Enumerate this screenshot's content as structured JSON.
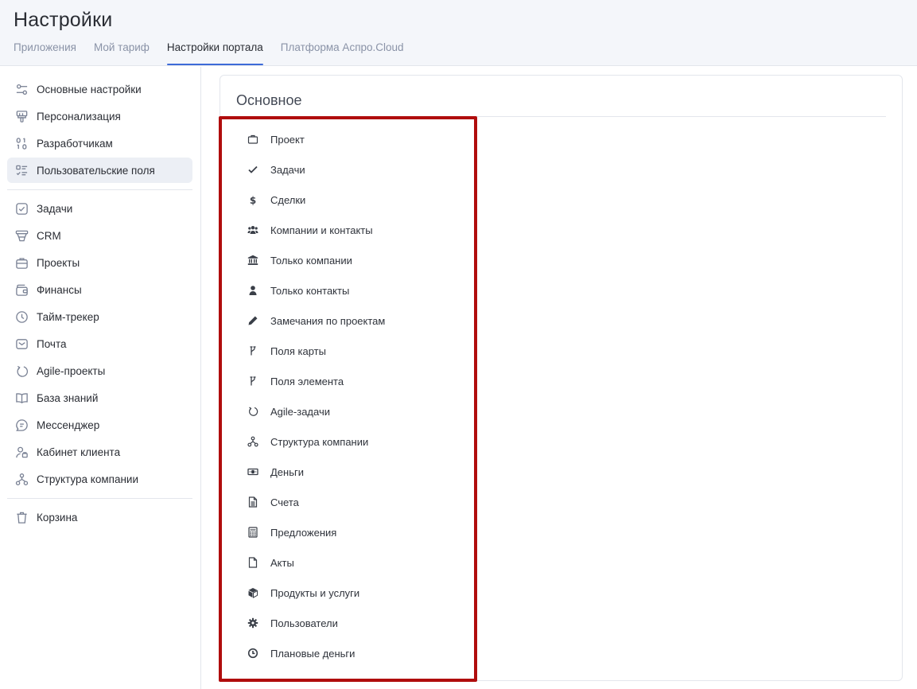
{
  "header": {
    "title": "Настройки",
    "tabs": [
      {
        "label": "Приложения"
      },
      {
        "label": "Мой тариф"
      },
      {
        "label": "Настройки портала"
      },
      {
        "label": "Платформа Аспро.Cloud"
      }
    ],
    "active_tab": "Настройки портала"
  },
  "sidebar": {
    "group1": [
      {
        "label": "Основные настройки",
        "icon": "sliders-icon"
      },
      {
        "label": "Персонализация",
        "icon": "paint-roller-icon"
      },
      {
        "label": "Разработчикам",
        "icon": "binary-code-icon"
      },
      {
        "label": "Пользовательские поля",
        "icon": "checklist-icon"
      }
    ],
    "group2": [
      {
        "label": "Задачи",
        "icon": "checkbox-icon"
      },
      {
        "label": "CRM",
        "icon": "funnel-icon"
      },
      {
        "label": "Проекты",
        "icon": "briefcase-icon"
      },
      {
        "label": "Финансы",
        "icon": "wallet-icon"
      },
      {
        "label": "Тайм-трекер",
        "icon": "clock-icon"
      },
      {
        "label": "Почта",
        "icon": "envelope-icon"
      },
      {
        "label": "Agile-проекты",
        "icon": "cycle-arrow-icon"
      },
      {
        "label": "База знаний",
        "icon": "open-book-icon"
      },
      {
        "label": "Мессенджер",
        "icon": "chat-bubble-icon"
      },
      {
        "label": "Кабинет клиента",
        "icon": "client-cabinet-icon"
      },
      {
        "label": "Структура компании",
        "icon": "org-structure-icon"
      }
    ],
    "group3": [
      {
        "label": "Корзина",
        "icon": "trash-icon"
      }
    ],
    "active_item": "Пользовательские поля"
  },
  "main": {
    "section_title": "Основное",
    "fields": [
      {
        "label": "Проект",
        "icon": "briefcase-icon"
      },
      {
        "label": "Задачи",
        "icon": "checkmark-icon"
      },
      {
        "label": "Сделки",
        "icon": "dollar-icon"
      },
      {
        "label": "Компании и контакты",
        "icon": "users-icon"
      },
      {
        "label": "Только компании",
        "icon": "bank-icon"
      },
      {
        "label": "Только контакты",
        "icon": "user-icon"
      },
      {
        "label": "Замечания по проектам",
        "icon": "pencil-icon"
      },
      {
        "label": "Поля карты",
        "icon": "branch-icon"
      },
      {
        "label": "Поля элемента",
        "icon": "branch-icon"
      },
      {
        "label": "Agile-задачи",
        "icon": "cycle-arrow-icon"
      },
      {
        "label": "Структура компании",
        "icon": "org-structure-icon"
      },
      {
        "label": "Деньги",
        "icon": "banknote-icon"
      },
      {
        "label": "Счета",
        "icon": "document-text-icon"
      },
      {
        "label": "Предложения",
        "icon": "calculator-icon"
      },
      {
        "label": "Акты",
        "icon": "document-icon"
      },
      {
        "label": "Продукты и услуги",
        "icon": "cube-icon"
      },
      {
        "label": "Пользователи",
        "icon": "gear-icon"
      },
      {
        "label": "Плановые деньги",
        "icon": "clock-icon"
      }
    ]
  },
  "colors": {
    "accent": "#3d6bd8",
    "highlight_border": "#b00d0d",
    "header_bg": "#f4f6fa",
    "active_item_bg": "#eceff5",
    "muted_text": "#8a93a7"
  }
}
